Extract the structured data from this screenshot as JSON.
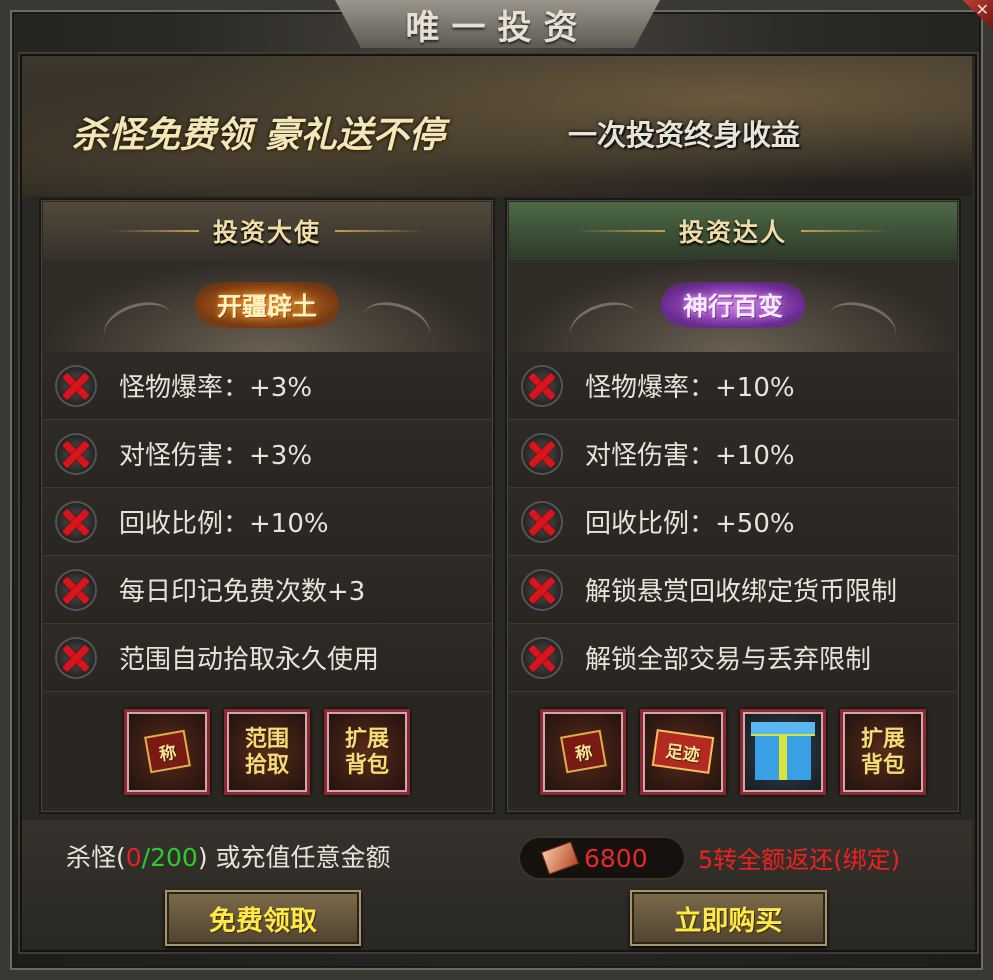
{
  "window": {
    "title": "唯一投资"
  },
  "banner": {
    "slogan_left": "杀怪免费领 豪礼送不停",
    "slogan_right": "一次投资终身收益"
  },
  "panels": [
    {
      "name": "投资大使",
      "emblem": "开疆辟土",
      "perks": [
        "怪物爆率：+3%",
        "对怪伤害：+3%",
        "回收比例：+10%",
        "每日印记免费次数+3",
        "范围自动拾取永久使用"
      ],
      "rewards": [
        "称",
        "范围拾取",
        "扩展背包"
      ],
      "reward_icons": [
        "title-plaque-icon",
        "range-pickup-icon",
        "expand-bag-icon"
      ]
    },
    {
      "name": "投资达人",
      "emblem": "神行百变",
      "perks": [
        "怪物爆率：+10%",
        "对怪伤害：+10%",
        "回收比例：+50%",
        "解锁悬赏回收绑定货币限制",
        "解锁全部交易与丢弃限制"
      ],
      "rewards": [
        "称",
        "足迹",
        "",
        "扩展背包"
      ],
      "reward_icons": [
        "title-plaque-icon",
        "footprint-plaque-icon",
        "gift-box-icon",
        "expand-bag-icon"
      ]
    }
  ],
  "bottom": {
    "kill_prefix": "杀怪(",
    "kill_current": "0",
    "kill_total": "/200",
    "kill_suffix": ") 或充值任意金额",
    "price": "6800",
    "refund_text": "5转全额返还(绑定)",
    "free_button": "免费领取",
    "buy_button": "立即购买"
  },
  "colors": {
    "accent_red": "#e8202a",
    "progress_green": "#2ecb2e",
    "button_text": "#ffe84a"
  },
  "icons": {
    "close": "close-icon",
    "unmet": "x-mark-icon",
    "currency": "coupon-icon"
  }
}
